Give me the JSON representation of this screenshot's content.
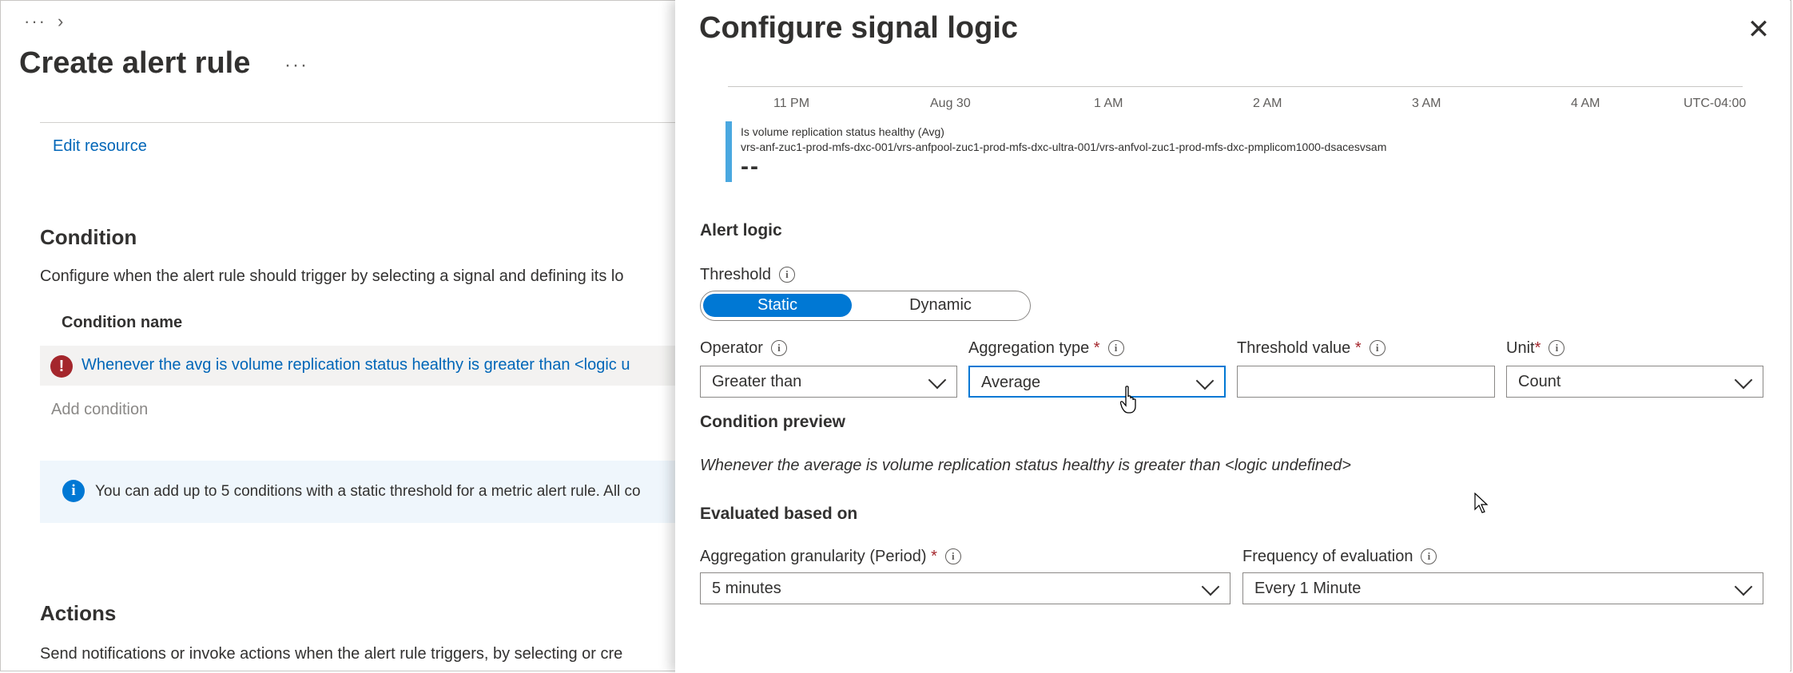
{
  "breadcrumb": {
    "more": "···",
    "chevron": "›"
  },
  "page": {
    "title": "Create alert rule",
    "more": "···",
    "edit_resource": "Edit resource"
  },
  "condition": {
    "heading": "Condition",
    "description": "Configure when the alert rule should trigger by selecting a signal and defining its lo",
    "column_header": "Condition name",
    "row_text": "Whenever the avg is volume replication status healthy is greater than <logic u",
    "error_glyph": "!",
    "add_condition": "Add condition",
    "info_glyph": "i",
    "info_text": "You can add up to 5 conditions with a static threshold for a metric alert rule. All co"
  },
  "actions": {
    "heading": "Actions",
    "description": "Send notifications or invoke actions when the alert rule triggers, by selecting or cre"
  },
  "panel": {
    "title": "Configure signal logic",
    "close": "✕",
    "chart": {
      "ticks": [
        "11 PM",
        "Aug 30",
        "1 AM",
        "2 AM",
        "3 AM",
        "4 AM",
        "UTC-04:00"
      ],
      "legend_metric": "Is volume replication status healthy (Avg)",
      "legend_resource": "vrs-anf-zuc1-prod-mfs-dxc-001/vrs-anfpool-zuc1-prod-mfs-dxc-ultra-001/vrs-anfvol-zuc1-prod-mfs-dxc-pmplicom1000-dsacesvsam",
      "legend_value": "--",
      "legend_color": "#4aa8e0"
    },
    "alert_logic": {
      "heading": "Alert logic",
      "threshold_label": "Threshold",
      "threshold_options": [
        "Static",
        "Dynamic"
      ],
      "threshold_selected": "Static",
      "operator_label": "Operator",
      "operator_value": "Greater than",
      "aggregation_label": "Aggregation type",
      "aggregation_value": "Average",
      "threshold_value_label": "Threshold value",
      "threshold_value": "",
      "unit_label": "Unit",
      "unit_value": "Count",
      "required_mark": "*",
      "info_glyph": "i"
    },
    "condition_preview": {
      "heading": "Condition preview",
      "text": "Whenever the average is volume replication status healthy is greater than <logic undefined>"
    },
    "evaluation": {
      "heading": "Evaluated based on",
      "granularity_label": "Aggregation granularity (Period)",
      "granularity_value": "5 minutes",
      "frequency_label": "Frequency of evaluation",
      "frequency_value": "Every 1 Minute"
    }
  },
  "colors": {
    "accent": "#0078d4",
    "link": "#0066b8",
    "error": "#a4262c"
  }
}
